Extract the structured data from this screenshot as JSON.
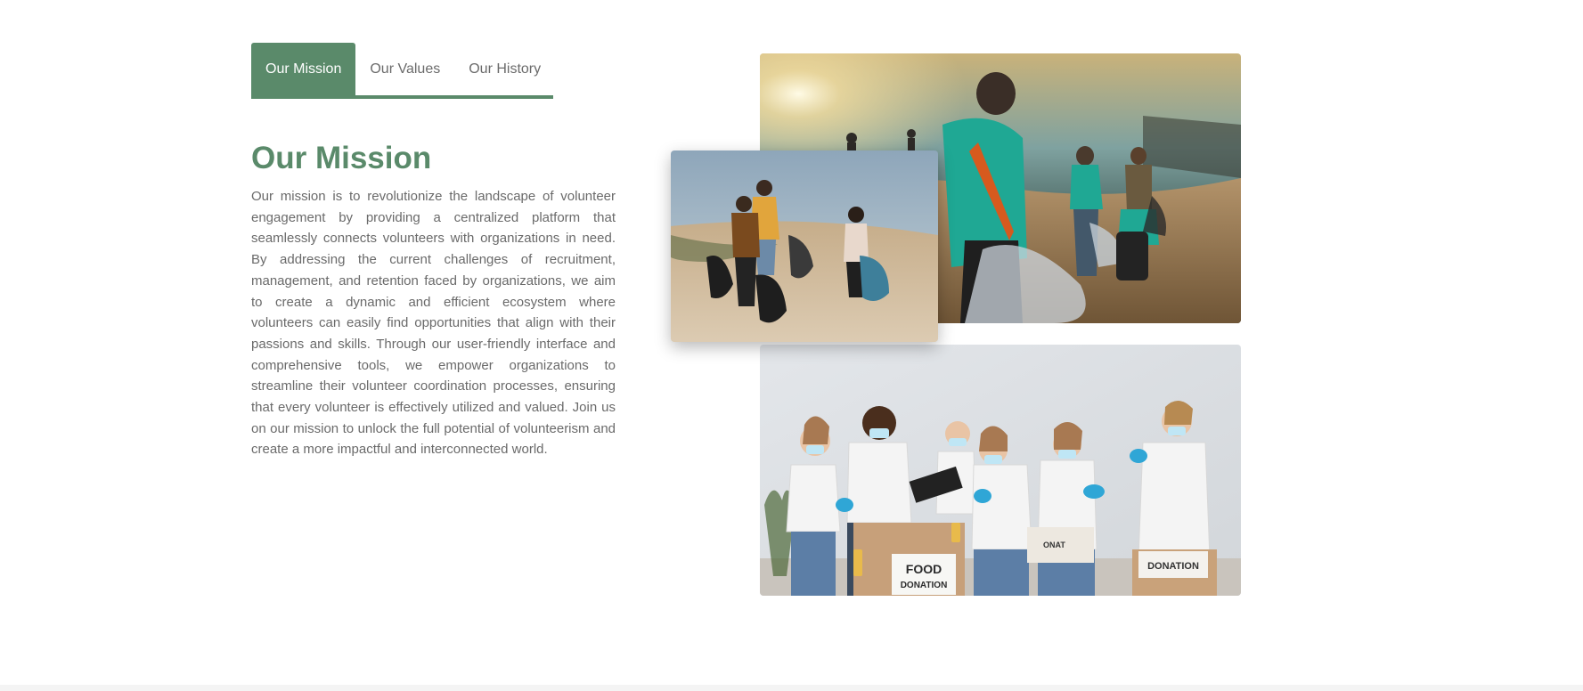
{
  "tabs": [
    {
      "label": "Our Mission",
      "active": true
    },
    {
      "label": "Our Values",
      "active": false
    },
    {
      "label": "Our History",
      "active": false
    }
  ],
  "mission": {
    "title": "Our Mission",
    "body": "Our mission is to revolutionize the landscape of volunteer engagement by providing a centralized platform that seamlessly connects volunteers with organizations in need. By addressing the current challenges of recruitment, management, and retention faced by organizations, we aim to create a dynamic and efficient ecosystem where volunteers can easily find opportunities that align with their passions and skills. Through our user-friendly interface and comprehensive tools, we empower organizations to streamline their volunteer coordination processes, ensuring that every volunteer is effectively utilized and valued. Join us on our mission to unlock the full potential of volunteerism and create a more impactful and interconnected world."
  },
  "photos": {
    "donation_box_food": "FOOD",
    "donation_box_food_sub": "DONATION",
    "donation_box_right": "DONATION",
    "donation_box_partial": "ONAT"
  },
  "colors": {
    "accent": "#5a8a6a",
    "text": "#6a6a6a"
  }
}
